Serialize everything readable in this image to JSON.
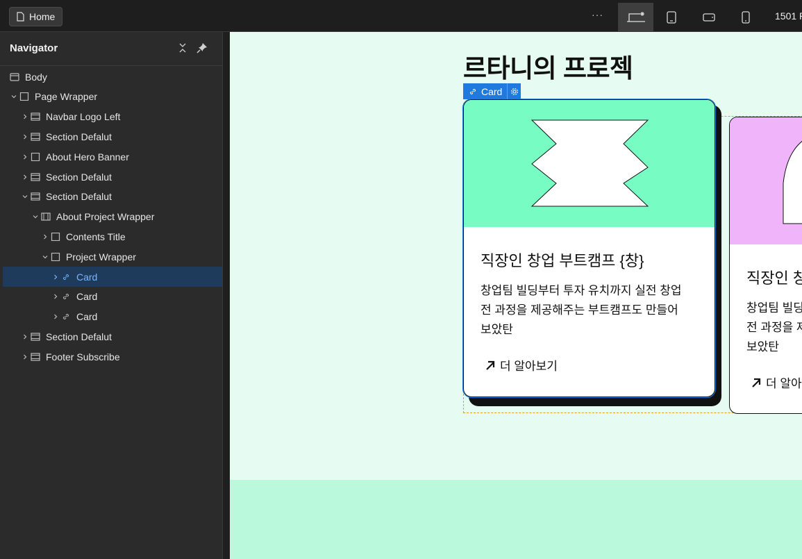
{
  "topbar": {
    "page_name": "Home",
    "more_label": "···",
    "breakpoints": [
      "desktop-base",
      "tablet",
      "mobile-landscape",
      "mobile-portrait"
    ],
    "width_readout": "1501 P"
  },
  "navigator": {
    "title": "Navigator",
    "items": [
      {
        "label": "Body",
        "icon": "body-icon",
        "expanded": null
      },
      {
        "label": "Page Wrapper",
        "icon": "box-icon",
        "expanded": true
      },
      {
        "label": "Navbar Logo Left",
        "icon": "section-icon",
        "expanded": false
      },
      {
        "label": "Section Defalut",
        "icon": "section-icon",
        "expanded": false
      },
      {
        "label": "About Hero Banner",
        "icon": "box-icon",
        "expanded": false
      },
      {
        "label": "Section Defalut",
        "icon": "section-icon",
        "expanded": false
      },
      {
        "label": "Section Defalut",
        "icon": "section-icon",
        "expanded": true
      },
      {
        "label": "About Project Wrapper",
        "icon": "container-icon",
        "expanded": true
      },
      {
        "label": "Contents Title",
        "icon": "box-icon",
        "expanded": false
      },
      {
        "label": "Project Wrapper",
        "icon": "box-icon",
        "expanded": true
      },
      {
        "label": "Card",
        "icon": "link-icon",
        "expanded": false,
        "selected": true
      },
      {
        "label": "Card",
        "icon": "link-icon",
        "expanded": false
      },
      {
        "label": "Card",
        "icon": "link-icon",
        "expanded": false
      },
      {
        "label": "Section Defalut",
        "icon": "section-icon",
        "expanded": false
      },
      {
        "label": "Footer Subscribe",
        "icon": "section-icon",
        "expanded": false
      }
    ]
  },
  "canvas": {
    "heading": "르타니의 프로젝",
    "selection_badge": "Card",
    "cards": [
      {
        "title": "직장인 창업 부트캠프 {창}",
        "desc_lines": [
          "창업팀 빌딩부터 투자 유치까지 실전 창업",
          "전 과정을 제공해주는 부트캠프도 만들어",
          "보았탄"
        ],
        "link": "더 알아보기",
        "image_color": "#77fdc4"
      },
      {
        "title": "직장인 창",
        "desc_lines": [
          "창업팀 빌딩",
          "전 과정을 제",
          "보았탄"
        ],
        "link": "더 알아",
        "image_color": "#f0b4fb"
      }
    ]
  },
  "colors": {
    "canvas_bg": "#e6fbf1",
    "footer_bg": "#baf9dc",
    "selection_blue": "#1f7ae0",
    "selected_row_bg": "#1f3b5c"
  }
}
